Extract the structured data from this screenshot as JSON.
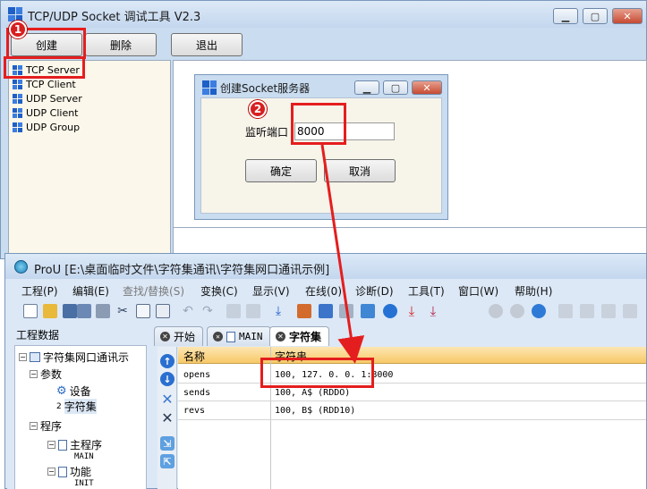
{
  "tool": {
    "title": "TCP/UDP Socket 调试工具 V2.3",
    "buttons": {
      "create": "创建",
      "delete": "删除",
      "exit": "退出"
    },
    "tree": [
      "TCP Server",
      "TCP Client",
      "UDP Server",
      "UDP Client",
      "UDP Group"
    ]
  },
  "dialog": {
    "title": "创建Socket服务器",
    "port_label": "监听端口",
    "port_value": "8000",
    "ok": "确定",
    "cancel": "取消"
  },
  "prou": {
    "title": "ProU [E:\\桌面临时文件\\字符集通讯\\字符集网口通讯示例]",
    "menu": [
      "工程(P)",
      "编辑(E)",
      "查找/替换(S)",
      "变换(C)",
      "显示(V)",
      "在线(0)",
      "诊断(D)",
      "工具(T)",
      "窗口(W)",
      "帮助(H)"
    ],
    "panel_title": "工程数据",
    "project": {
      "root": "字符集网口通讯示",
      "params": "参数",
      "device": "设备",
      "charset_num": "2",
      "charset": "字符集",
      "program": "程序",
      "main_program": "主程序",
      "main_tag": "MAIN",
      "function": "功能",
      "init_tag": "INIT"
    },
    "tabs": [
      "开始",
      "MAIN",
      "字符集"
    ],
    "grid": {
      "headers": [
        "名称",
        "字符串"
      ],
      "rows": [
        {
          "name": "opens",
          "value": "100, 127. 0. 0. 1:8000"
        },
        {
          "name": "sends",
          "value": "100, A$ (RDDO)"
        },
        {
          "name": "revs",
          "value": "100, B$ (RDD10)"
        }
      ]
    }
  },
  "annotations": {
    "badge1": "1",
    "badge2": "2"
  },
  "colors": {
    "annotation": "#e41e1e",
    "grid_header": "#f7c968"
  }
}
